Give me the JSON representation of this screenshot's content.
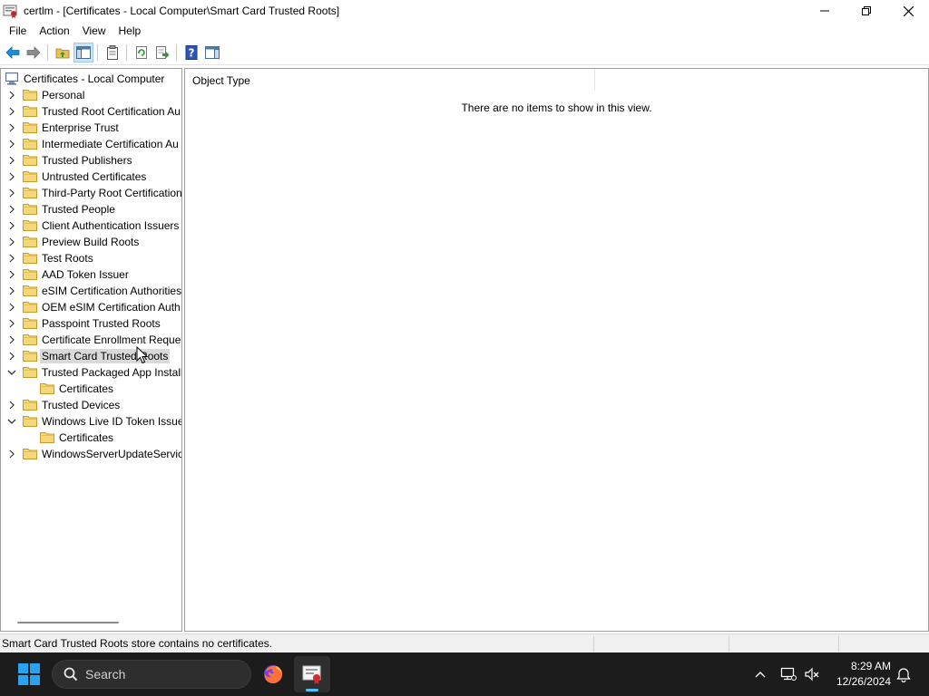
{
  "window": {
    "title": "certlm - [Certificates - Local Computer\\Smart Card Trusted Roots]",
    "controls": {
      "minimize": "minimize-icon",
      "maximize": "restore-icon",
      "close": "close-icon"
    }
  },
  "menu": {
    "items": [
      {
        "label": "File"
      },
      {
        "label": "Action"
      },
      {
        "label": "View"
      },
      {
        "label": "Help"
      }
    ]
  },
  "toolbar": {
    "buttons": [
      "back-arrow-icon",
      "forward-arrow-icon",
      "up-folder-icon",
      "show-hide-tree-icon",
      "properties-icon",
      "refresh-icon",
      "export-list-icon",
      "help-icon",
      "show-hide-action-pane-icon"
    ]
  },
  "tree": {
    "root": "Certificates - Local Computer",
    "nodes": [
      {
        "label": "Personal",
        "level": 1,
        "expanded": false
      },
      {
        "label": "Trusted Root Certification Au",
        "level": 1,
        "expanded": false
      },
      {
        "label": "Enterprise Trust",
        "level": 1,
        "expanded": false
      },
      {
        "label": "Intermediate Certification Au",
        "level": 1,
        "expanded": false
      },
      {
        "label": "Trusted Publishers",
        "level": 1,
        "expanded": false
      },
      {
        "label": "Untrusted Certificates",
        "level": 1,
        "expanded": false
      },
      {
        "label": "Third-Party Root Certification",
        "level": 1,
        "expanded": false
      },
      {
        "label": "Trusted People",
        "level": 1,
        "expanded": false
      },
      {
        "label": "Client Authentication Issuers",
        "level": 1,
        "expanded": false
      },
      {
        "label": "Preview Build Roots",
        "level": 1,
        "expanded": false
      },
      {
        "label": "Test Roots",
        "level": 1,
        "expanded": false
      },
      {
        "label": "AAD Token Issuer",
        "level": 1,
        "expanded": false
      },
      {
        "label": "eSIM Certification Authorities",
        "level": 1,
        "expanded": false
      },
      {
        "label": "OEM eSIM Certification Auth",
        "level": 1,
        "expanded": false
      },
      {
        "label": "Passpoint Trusted Roots",
        "level": 1,
        "expanded": false
      },
      {
        "label": "Certificate Enrollment Reque:",
        "level": 1,
        "expanded": false
      },
      {
        "label": "Smart Card Trusted Roots",
        "level": 1,
        "expanded": false,
        "selected": true
      },
      {
        "label": "Trusted Packaged App Install",
        "level": 1,
        "expanded": true
      },
      {
        "label": "Certificates",
        "level": 2,
        "leaf": true
      },
      {
        "label": "Trusted Devices",
        "level": 1,
        "expanded": false
      },
      {
        "label": "Windows Live ID Token Issuer",
        "level": 1,
        "expanded": true
      },
      {
        "label": "Certificates",
        "level": 2,
        "leaf": true
      },
      {
        "label": "WindowsServerUpdateService",
        "level": 1,
        "expanded": false
      }
    ]
  },
  "list": {
    "column_header": "Object Type",
    "empty_message": "There are no items to show in this view."
  },
  "status": {
    "text": "Smart Card Trusted Roots store contains no certificates."
  },
  "taskbar": {
    "search_label": "Search",
    "apps": [
      "firefox-icon",
      "certlm-icon"
    ],
    "time": "8:29 AM",
    "date": "12/26/2024",
    "accent_color": "#4cc2ff"
  }
}
